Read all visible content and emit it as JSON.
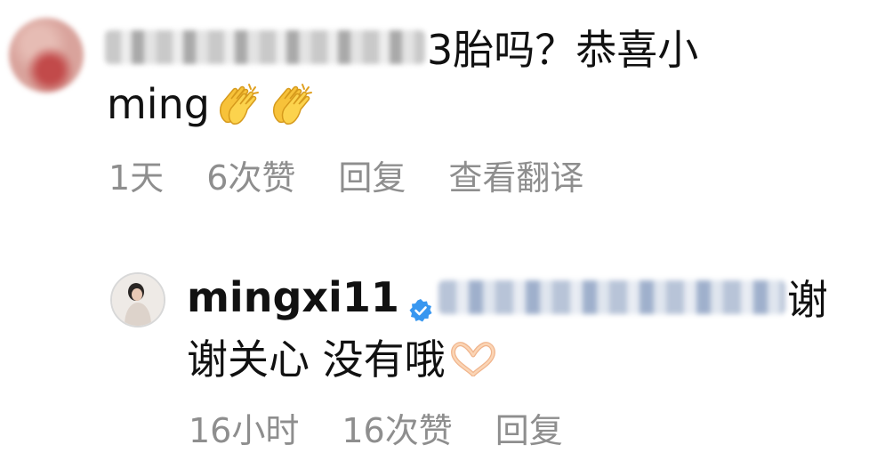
{
  "comment": {
    "avatar_icon": "blurred-profile-avatar",
    "text_suffix": "3胎吗？恭喜小",
    "text_line2": "ming",
    "emojis": [
      "clapping-hands",
      "clapping-hands"
    ],
    "time": "1天",
    "likes": "6次赞",
    "reply_label": "回复",
    "translate_label": "查看翻译"
  },
  "reply": {
    "avatar_icon": "profile-avatar",
    "username": "mingxi11",
    "verified_icon": "verified-badge",
    "text_suffix": "谢",
    "text_line2": "谢关心 没有哦",
    "emoji": "heart-hands",
    "time": "16小时",
    "likes": "16次赞",
    "reply_label": "回复"
  },
  "colors": {
    "text": "#111111",
    "meta": "#8e8e8e",
    "verified": "#3897f0"
  }
}
